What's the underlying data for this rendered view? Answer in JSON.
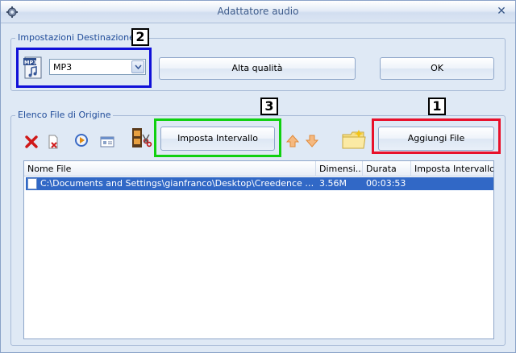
{
  "window": {
    "title": "Adattatore audio",
    "close_glyph": "✕"
  },
  "destination": {
    "group_label": "Impostazioni Destinazione",
    "format_value": "MP3",
    "quality_button": "Alta qualità",
    "ok_button": "OK",
    "format_icon": "mp3-file-icon"
  },
  "sources": {
    "group_label": "Elenco File di Origine",
    "interval_button": "Imposta Intervallo",
    "add_button": "Aggiungi File",
    "toolbar_icons": [
      "delete-icon",
      "remove-file-icon",
      "play-icon",
      "properties-icon",
      "film-cut-icon",
      "move-up-icon",
      "move-down-icon",
      "open-folder-icon"
    ]
  },
  "file_list": {
    "columns": [
      "Nome File",
      "Dimensi...",
      "Durata",
      "Imposta Intervallo"
    ],
    "rows": [
      {
        "name": "C:\\Documents and Settings\\gianfranco\\Desktop\\Creedence - Sailor lam...",
        "size": "3.56M",
        "duration": "00:03:53",
        "interval": ""
      }
    ]
  },
  "annotations": {
    "one": "1",
    "two": "2",
    "three": "3",
    "colors": {
      "one": "#e8102a",
      "two": "#1010d8",
      "three": "#10d010"
    }
  },
  "colors": {
    "selection": "#3168c6",
    "title_text": "#3c5a8a",
    "group_label": "#1f4b99"
  }
}
